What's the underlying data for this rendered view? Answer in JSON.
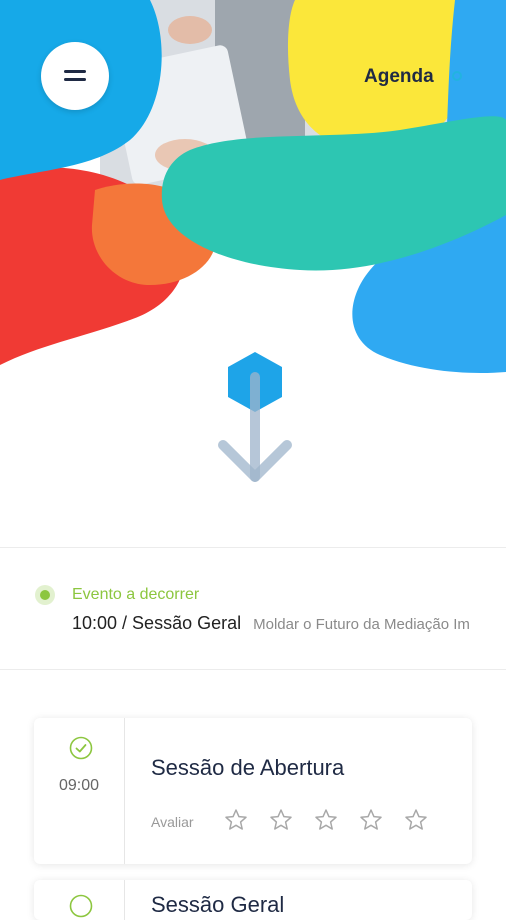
{
  "header": {
    "title": "Agenda",
    "menu_icon": "menu-icon"
  },
  "colors": {
    "blue": "#16a9e8",
    "yellow": "#fbe73a",
    "teal": "#2dc6b2",
    "red": "#f03a34",
    "orange": "#f4773a",
    "green": "#8cc63f",
    "navy": "#1f2a44"
  },
  "scroll_hint": {
    "icon": "scroll-down-arrow-icon"
  },
  "current_event": {
    "label": "Evento a decorrer",
    "session": "10:00 / Sessão Geral",
    "description": "Moldar o Futuro da Mediação Im"
  },
  "agenda": [
    {
      "time": "09:00",
      "title": "Sessão de Abertura",
      "rate_label": "Avaliar",
      "rating": 0,
      "max_rating": 5
    },
    {
      "title": "Sessão Geral"
    }
  ]
}
